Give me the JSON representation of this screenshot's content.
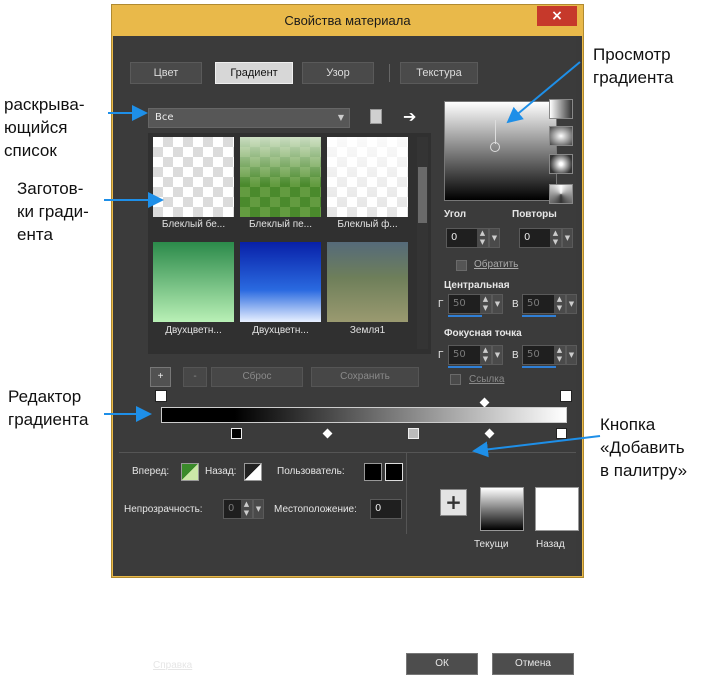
{
  "window": {
    "title": "Свойства материала",
    "close_label": "×"
  },
  "tabs": [
    {
      "label": "Цвет"
    },
    {
      "label": "Градиент"
    },
    {
      "label": "Узор"
    },
    {
      "label": "Текстура"
    }
  ],
  "dropdown": {
    "value": "Все"
  },
  "presets": [
    {
      "label": "Блеклый бе..."
    },
    {
      "label": "Блеклый пе..."
    },
    {
      "label": "Блеклый ф..."
    },
    {
      "label": "Двухцветн..."
    },
    {
      "label": "Двухцветн..."
    },
    {
      "label": "Земля1"
    }
  ],
  "preset_buttons": {
    "add": "+",
    "remove": "-",
    "reset": "Сброс",
    "save": "Сохранить"
  },
  "settings": {
    "angle_label": "Угол",
    "angle_value": "0",
    "repeats_label": "Повторы",
    "repeats_value": "0",
    "invert_label": "Обратить",
    "center_label": "Центральная",
    "center_h_label": "Г",
    "center_h_value": "50",
    "center_v_label": "В",
    "center_v_value": "50",
    "focus_label": "Фокусная точка",
    "focus_h_label": "Г",
    "focus_h_value": "50",
    "focus_v_label": "В",
    "focus_v_value": "50",
    "link_label": "Ссылка"
  },
  "editor": {
    "forward_label": "Вперед:",
    "back_label": "Назад:",
    "user_label": "Пользователь:",
    "opacity_label": "Непрозрачность:",
    "opacity_value": "0",
    "location_label": "Местоположение:",
    "location_value": "0"
  },
  "palette": {
    "add_label": "+",
    "current_label": "Текущи",
    "back_label": "Назад"
  },
  "footer": {
    "help_label": "Справка",
    "ok_label": "ОК",
    "cancel_label": "Отмена"
  },
  "annotations": {
    "dropdown_lines": [
      "раскрыва-",
      "ющийся",
      "список"
    ],
    "presets_lines": [
      "Заготов-",
      "ки гради-",
      "ента"
    ],
    "editor_lines": [
      "Редактор",
      "градиента"
    ],
    "preview_lines": [
      "Просмотр",
      "градиента"
    ],
    "addbtn_lines": [
      "Кнопка",
      "«Добавить",
      "в палитру»"
    ]
  },
  "colors": {
    "title_bar": "#e9b94a",
    "dialog_bg": "#3b3b3b",
    "accent_blue": "#2f7fd6",
    "arrow_blue": "#1e8fe8"
  }
}
